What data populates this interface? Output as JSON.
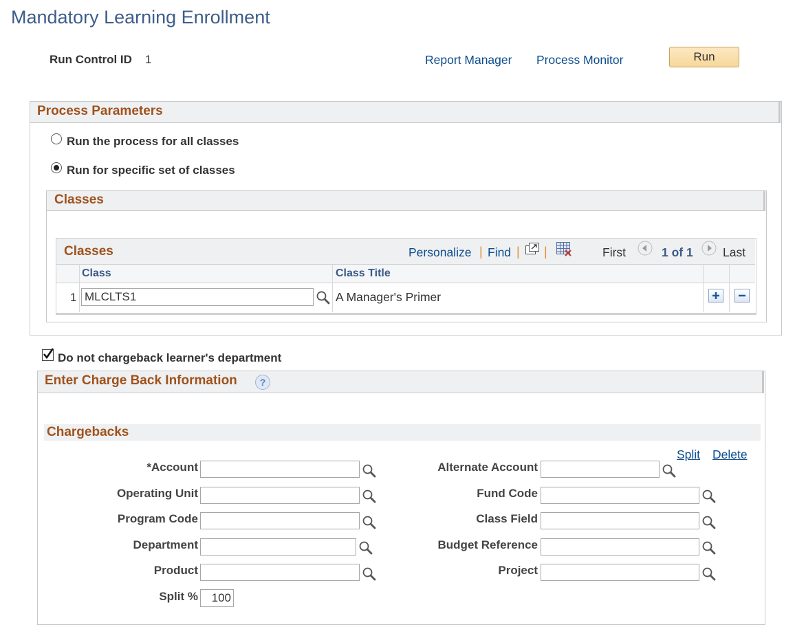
{
  "page": {
    "title": "Mandatory Learning Enrollment"
  },
  "toolbar": {
    "run_control_label": "Run Control ID",
    "run_control_value": "1",
    "report_manager": "Report Manager",
    "process_monitor": "Process Monitor",
    "run_label": "Run"
  },
  "process_parameters": {
    "header": "Process Parameters",
    "options": [
      {
        "label": "Run the process for all classes",
        "selected": false
      },
      {
        "label": "Run for specific set of classes",
        "selected": true
      }
    ]
  },
  "classes_box": {
    "header": "Classes",
    "grid": {
      "title": "Classes",
      "personalize": "Personalize",
      "find": "Find",
      "separator": "|",
      "first": "First",
      "page_info": "1 of 1",
      "last": "Last",
      "columns": [
        "Class",
        "Class Title"
      ],
      "rows": [
        {
          "num": "1",
          "class": "MLCLTS1",
          "title": "A Manager's Primer"
        }
      ]
    }
  },
  "chargeback_checkbox": {
    "label": "Do not chargeback learner's department",
    "checked": true
  },
  "charge_back": {
    "header": "Enter Charge Back Information",
    "section": "Chargebacks",
    "split_link": "Split",
    "delete_link": "Delete",
    "fields": {
      "account": {
        "label": "*Account",
        "value": ""
      },
      "operating_unit": {
        "label": "Operating Unit",
        "value": ""
      },
      "program_code": {
        "label": "Program Code",
        "value": ""
      },
      "department": {
        "label": "Department",
        "value": ""
      },
      "product": {
        "label": "Product",
        "value": ""
      },
      "split_pct": {
        "label": "Split %",
        "value": "100"
      },
      "alternate_account": {
        "label": "Alternate Account",
        "value": ""
      },
      "fund_code": {
        "label": "Fund Code",
        "value": ""
      },
      "class_field": {
        "label": "Class Field",
        "value": ""
      },
      "budget_reference": {
        "label": "Budget Reference",
        "value": ""
      },
      "project": {
        "label": "Project",
        "value": ""
      }
    }
  },
  "colors": {
    "title": "#3e5d8a",
    "header_text": "#a0521c",
    "link": "#0c4c8c",
    "run_button": "#f7d79a"
  },
  "icons": [
    "search-icon",
    "help-icon",
    "zoom-grid-icon",
    "download-grid-icon",
    "previous-icon",
    "next-icon",
    "add-row-icon",
    "delete-row-icon",
    "checkmark-icon"
  ]
}
